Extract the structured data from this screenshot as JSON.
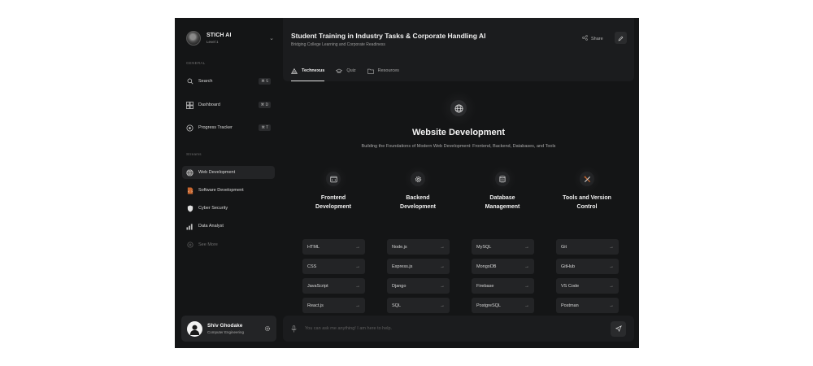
{
  "brand": {
    "name": "STICH AI",
    "level": "Level 1"
  },
  "sidebar": {
    "general_label": "GENERAL",
    "general": [
      {
        "label": "Search",
        "shortcut": "⌘ S",
        "icon": "search-icon"
      },
      {
        "label": "Dashboard",
        "shortcut": "⌘ D",
        "icon": "dashboard-icon"
      },
      {
        "label": "Progress Tracker",
        "shortcut": "⌘ T",
        "icon": "progress-icon"
      }
    ],
    "streams_label": "Streams",
    "streams": [
      {
        "label": "Web Development",
        "icon": "globe-icon",
        "active": true
      },
      {
        "label": "Software Development",
        "icon": "code-file-icon"
      },
      {
        "label": "Cyber Security",
        "icon": "shield-icon"
      },
      {
        "label": "Data Analyst",
        "icon": "bar-chart-icon"
      },
      {
        "label": "See More",
        "icon": "plus-circle-icon",
        "muted": true
      }
    ]
  },
  "user": {
    "name": "Shiv Ghodake",
    "role": "Computer Engineering"
  },
  "header": {
    "title": "Student Training in Industry Tasks & Corporate Handling AI",
    "subtitle": "Bridging College Learning and Corporate Readiness",
    "share_label": "Share",
    "tabs": [
      {
        "label": "Technexus",
        "active": true
      },
      {
        "label": "Quiz"
      },
      {
        "label": "Resources"
      }
    ]
  },
  "content": {
    "title": "Website Development",
    "subtitle": "Building the Foundations of Modern Web Development: Frontend, Backend, Databases, and Tools",
    "columns": [
      {
        "title_line1": "Frontend",
        "title_line2": "Development",
        "icon": "browser-code-icon",
        "items": [
          "HTML",
          "CSS",
          "JavaScript",
          "React.js"
        ]
      },
      {
        "title_line1": "Backend",
        "title_line2": "Development",
        "icon": "gear-icon",
        "items": [
          "Node.js",
          "Express.js",
          "Django",
          "SQL"
        ]
      },
      {
        "title_line1": "Database",
        "title_line2": "Management",
        "icon": "database-icon",
        "items": [
          "MySQL",
          "MongoDB",
          "Firebase",
          "PostgreSQL"
        ]
      },
      {
        "title_line1": "Tools and Version",
        "title_line2": "Control",
        "icon": "tools-icon",
        "items": [
          "Git",
          "GitHub",
          "VS Code",
          "Postman"
        ]
      }
    ]
  },
  "composer": {
    "placeholder": "You can ask me anything! I am here to help."
  },
  "colors": {
    "app_bg": "#141516",
    "panel_bg": "#1b1c1e",
    "chip_bg": "#232426",
    "text": "#f0f0f0",
    "muted": "#9a9a9a",
    "accent_web": "#c8662e"
  }
}
